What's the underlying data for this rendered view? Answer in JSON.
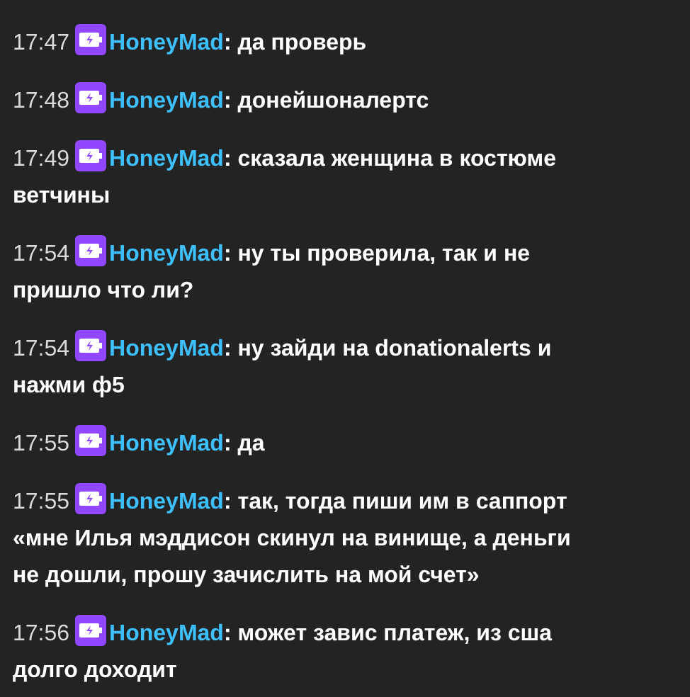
{
  "messages": [
    {
      "time": "17:47",
      "user": "HoneyMad",
      "lines": [
        ": да проверь"
      ]
    },
    {
      "time": "17:48",
      "user": "HoneyMad",
      "lines": [
        ": донейшоналертс"
      ]
    },
    {
      "time": "17:49",
      "user": "HoneyMad",
      "lines": [
        ": сказала женщина в костюме",
        "ветчины"
      ]
    },
    {
      "time": "17:54",
      "user": "HoneyMad",
      "lines": [
        ": ну ты проверила, так и не",
        "пришло что ли?"
      ]
    },
    {
      "time": "17:54",
      "user": "HoneyMad",
      "lines": [
        ": ну зайди на donationalerts и",
        "нажми ф5"
      ]
    },
    {
      "time": "17:55",
      "user": "HoneyMad",
      "lines": [
        ": да"
      ]
    },
    {
      "time": "17:55",
      "user": "HoneyMad",
      "lines": [
        ": так, тогда пиши им в саппорт",
        "«мне Илья мэддисон скинул на винище, а деньги",
        "не дошли, прошу зачислить на мой счет»"
      ]
    },
    {
      "time": "17:56",
      "user": "HoneyMad",
      "lines": [
        ": может завис платеж, из сша",
        "долго доходит"
      ]
    }
  ]
}
